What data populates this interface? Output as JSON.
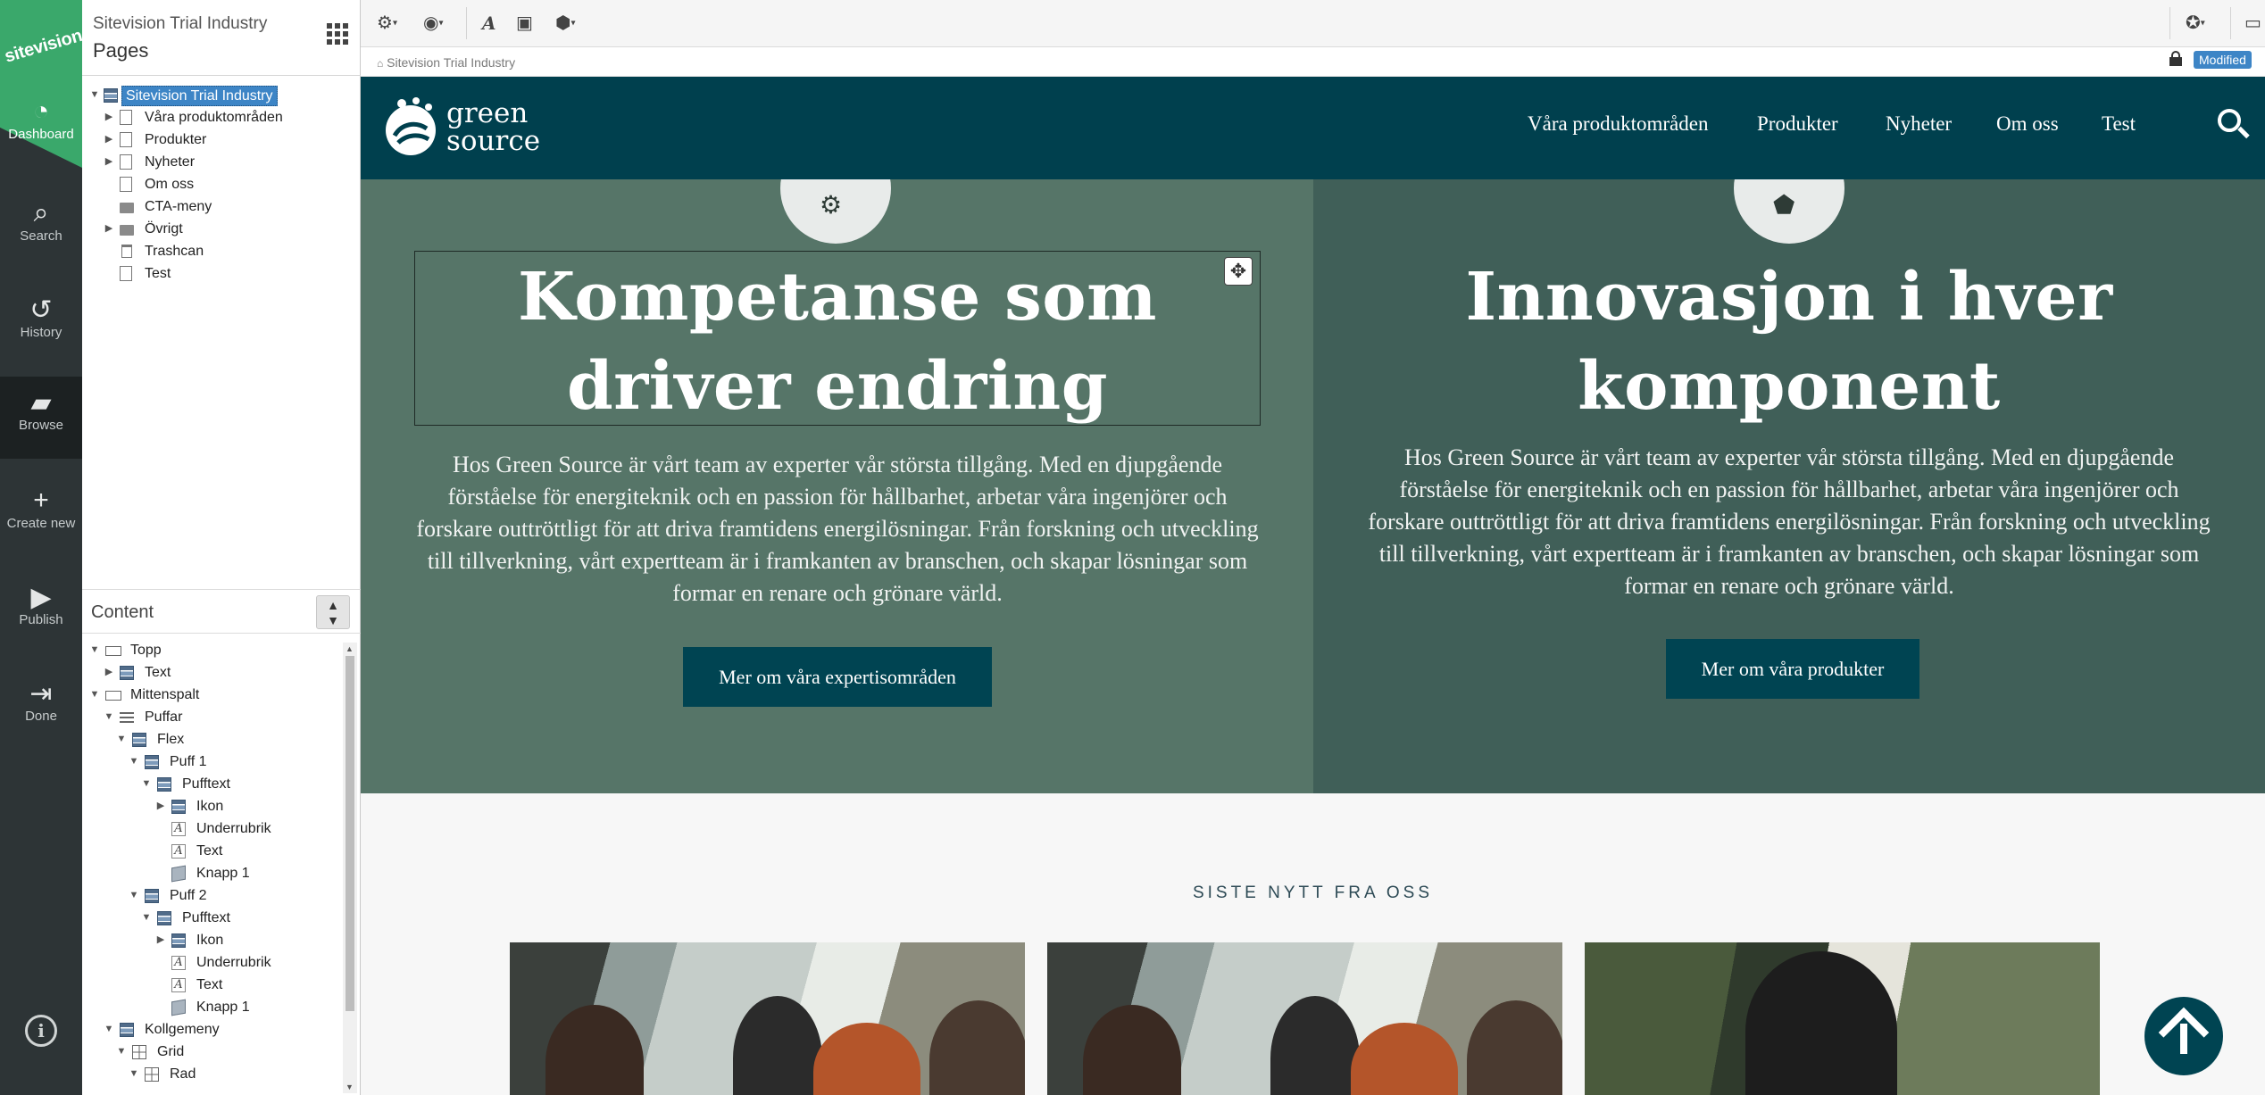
{
  "rail": {
    "logo": "sitevision.",
    "items": [
      {
        "label": "Dashboard",
        "icon": "gauge-icon"
      },
      {
        "label": "Search",
        "icon": "search-icon"
      },
      {
        "label": "History",
        "icon": "history-icon"
      },
      {
        "label": "Browse",
        "icon": "folder-open-icon"
      },
      {
        "label": "Create new",
        "icon": "plus-icon"
      },
      {
        "label": "Publish",
        "icon": "play-icon"
      },
      {
        "label": "Done",
        "icon": "exit-icon"
      }
    ],
    "info_icon": "i"
  },
  "panel": {
    "site_title": "Sitevision Trial Industry",
    "section_title": "Pages",
    "tree": [
      {
        "label": "Sitevision Trial Industry",
        "icon": "site-icon",
        "selected": true
      },
      {
        "label": "Våra produktområden",
        "icon": "page-icon"
      },
      {
        "label": "Produkter",
        "icon": "page-icon"
      },
      {
        "label": "Nyheter",
        "icon": "page-icon"
      },
      {
        "label": "Om oss",
        "icon": "page-icon"
      },
      {
        "label": "CTA-meny",
        "icon": "folder-icon"
      },
      {
        "label": "Övrigt",
        "icon": "folder-icon"
      },
      {
        "label": "Trashcan",
        "icon": "trash-icon"
      },
      {
        "label": "Test",
        "icon": "page-icon"
      }
    ],
    "content_title": "Content",
    "content_tree": [
      {
        "label": "Topp"
      },
      {
        "label": "Text"
      },
      {
        "label": "Mittenspalt"
      },
      {
        "label": "Puffar"
      },
      {
        "label": "Flex"
      },
      {
        "label": "Puff 1"
      },
      {
        "label": "Pufftext"
      },
      {
        "label": "Ikon"
      },
      {
        "label": "Underrubrik"
      },
      {
        "label": "Text"
      },
      {
        "label": "Knapp 1"
      },
      {
        "label": "Puff 2"
      },
      {
        "label": "Pufftext"
      },
      {
        "label": "Ikon"
      },
      {
        "label": "Underrubrik"
      },
      {
        "label": "Text"
      },
      {
        "label": "Knapp 1"
      },
      {
        "label": "Kollgemeny"
      },
      {
        "label": "Grid"
      },
      {
        "label": "Rad"
      }
    ]
  },
  "toolbar": {
    "breadcrumb": "Sitevision Trial Industry",
    "status_badge": "Modified"
  },
  "site": {
    "logo_line1": "green",
    "logo_line2": "source",
    "nav": [
      "Våra produktområden",
      "Produkter",
      "Nyheter",
      "Om oss",
      "Test"
    ],
    "puff1": {
      "heading_line1": "Kompetanse som",
      "heading_line2": "driver endring",
      "text": "Hos Green Source är vårt team av experter vår största tillgång. Med en djupgående förståelse för energiteknik och en passion för hållbarhet, arbetar våra ingenjörer och forskare outtröttligt för att driva framtidens energilösningar. Från forskning och utveckling till tillverkning, vårt expertteam är i framkanten av branschen, och skapar lösningar som formar en renare och grönare värld.",
      "button": "Mer om våra expertisområden"
    },
    "puff2": {
      "heading_line1": "Innovasjon i hver",
      "heading_line2": "komponent",
      "text": "Hos Green Source är vårt team av experter vår största tillgång. Med en djupgående förståelse för energiteknik och en passion för hållbarhet, arbetar våra ingenjörer och forskare outtröttligt för att driva framtidens energilösningar. Från forskning och utveckling till tillverkning, vårt expertteam är i framkanten av branschen, och skapar lösningar som formar en renare och grönare värld.",
      "button": "Mer om våra produkter"
    },
    "news_label": "SISTE NYTT FRA OSS"
  },
  "colors": {
    "rail": "#2d3436",
    "brand_green": "#3aa86b",
    "header": "#00404e",
    "puff1_bg": "#567568",
    "puff2_bg": "#405f58",
    "button": "#004452",
    "selection": "#3d85c6"
  }
}
